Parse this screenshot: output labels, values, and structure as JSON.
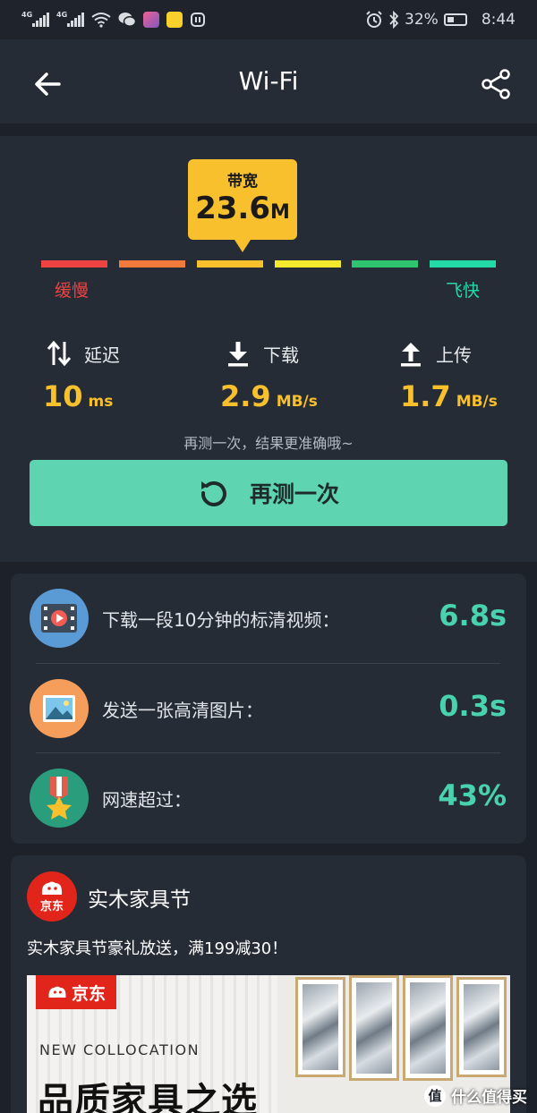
{
  "status_bar": {
    "sig1": "4G",
    "sig2": "4G",
    "battery": "32%",
    "time": "8:44"
  },
  "header": {
    "title": "Wi-Fi"
  },
  "speed": {
    "bandwidth_label": "带宽",
    "bandwidth_value": "23.6",
    "bandwidth_unit": "M",
    "slow_label": "缓慢",
    "fast_label": "飞快",
    "scale_colors": [
      "#ee4343",
      "#f47a3c",
      "#f7c02c",
      "#f3ea2d",
      "#2fc46f",
      "#24dba8"
    ],
    "latency_label": "延迟",
    "latency_value": "10",
    "latency_unit": "ms",
    "download_label": "下载",
    "download_value": "2.9",
    "download_unit": "MB/s",
    "upload_label": "上传",
    "upload_value": "1.7",
    "upload_unit": "MB/s",
    "hint": "再测一次，结果更准确哦~",
    "retest_label": "再测一次"
  },
  "stats": [
    {
      "label": "下载一段10分钟的标清视频：",
      "value": "6.8s",
      "icon": "video-icon",
      "color": "#5b9bd5"
    },
    {
      "label": "发送一张高清图片：",
      "value": "0.3s",
      "icon": "picture-icon",
      "color": "#f59d5a"
    },
    {
      "label": "网速超过：",
      "value": "43%",
      "icon": "medal-icon",
      "color": "#2a9d7c"
    }
  ],
  "ad": {
    "logo_text": "京东",
    "title": "实木家具节",
    "text": "实木家具节豪礼放送，满199减30！",
    "image_brand": "京东",
    "image_subtitle": "NEW COLLOCATION",
    "image_headline": "品质家具之选",
    "watermark": "什么值得买",
    "watermark_icon_text": "值"
  }
}
